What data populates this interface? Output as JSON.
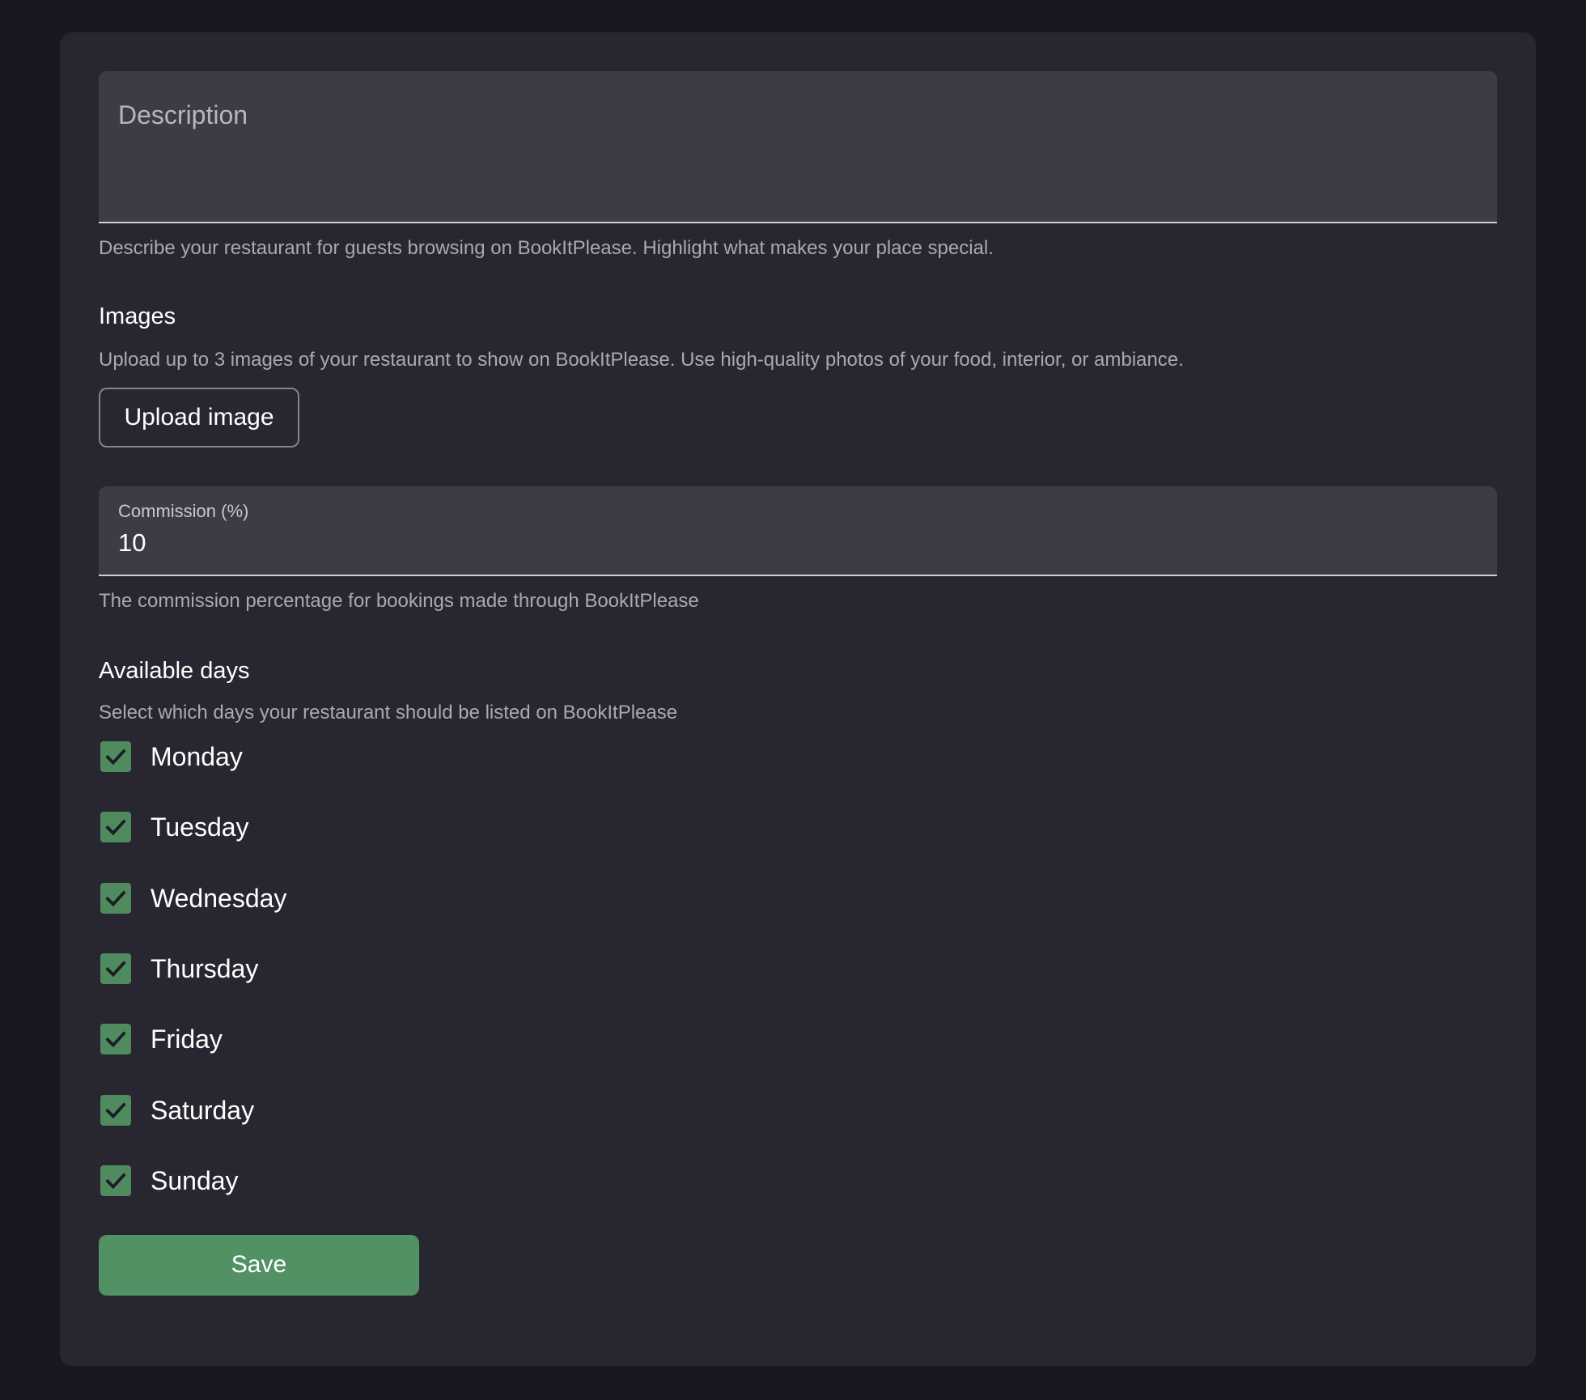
{
  "description": {
    "placeholder": "Description",
    "value": "",
    "helper": "Describe your restaurant for guests browsing on BookItPlease. Highlight what makes your place special."
  },
  "images": {
    "title": "Images",
    "helper": "Upload up to 3 images of your restaurant to show on BookItPlease. Use high-quality photos of your food, interior, or ambiance.",
    "upload_label": "Upload image"
  },
  "commission": {
    "label": "Commission (%)",
    "value": "10",
    "helper": "The commission percentage for bookings made through BookItPlease"
  },
  "available_days": {
    "title": "Available days",
    "helper": "Select which days your restaurant should be listed on BookItPlease",
    "days": [
      {
        "label": "Monday",
        "checked": true
      },
      {
        "label": "Tuesday",
        "checked": true
      },
      {
        "label": "Wednesday",
        "checked": true
      },
      {
        "label": "Thursday",
        "checked": true
      },
      {
        "label": "Friday",
        "checked": true
      },
      {
        "label": "Saturday",
        "checked": true
      },
      {
        "label": "Sunday",
        "checked": true
      }
    ]
  },
  "save_label": "Save",
  "colors": {
    "page_background": "#191822",
    "card_background": "#282731",
    "field_background": "#3d3c45",
    "accent_green": "#529164",
    "checkbox_green": "#4f8b5f"
  },
  "icons": {
    "checkbox": "check-icon"
  }
}
